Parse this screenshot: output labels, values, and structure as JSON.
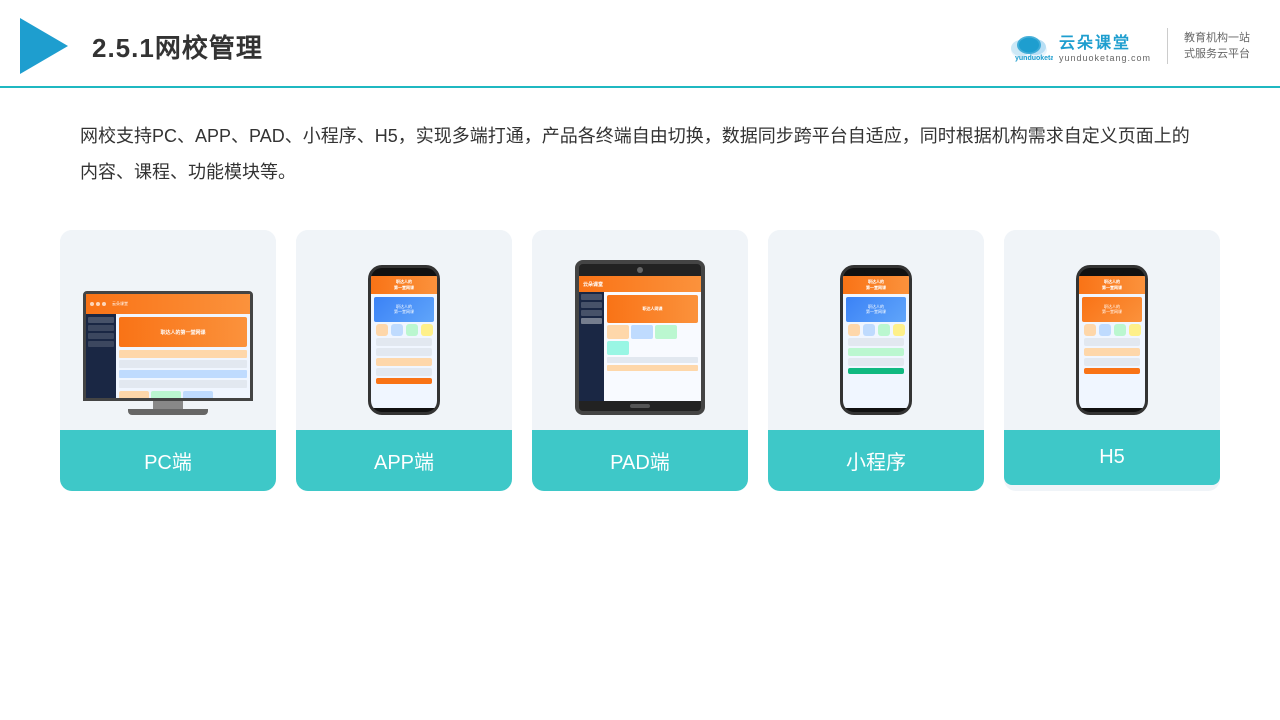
{
  "header": {
    "title": "2.5.1网校管理",
    "brand": {
      "name": "云朵课堂",
      "pinyin": "yunduoketang.com",
      "tagline": "教育机构一站\n式服务云平台"
    }
  },
  "description": "网校支持PC、APP、PAD、小程序、H5，实现多端打通，产品各终端自由切换，数据同步跨平台自适应，同时根据机构需求自定义页面上的内容、课程、功能模块等。",
  "cards": [
    {
      "id": "pc",
      "label": "PC端"
    },
    {
      "id": "app",
      "label": "APP端"
    },
    {
      "id": "pad",
      "label": "PAD端"
    },
    {
      "id": "mini",
      "label": "小程序"
    },
    {
      "id": "h5",
      "label": "H5"
    }
  ],
  "colors": {
    "accent": "#1fb8c1",
    "card_bg": "#f0f4f8",
    "label_bg": "#3ec8c8",
    "text_dark": "#333333",
    "brand_blue": "#1e9ecf"
  }
}
